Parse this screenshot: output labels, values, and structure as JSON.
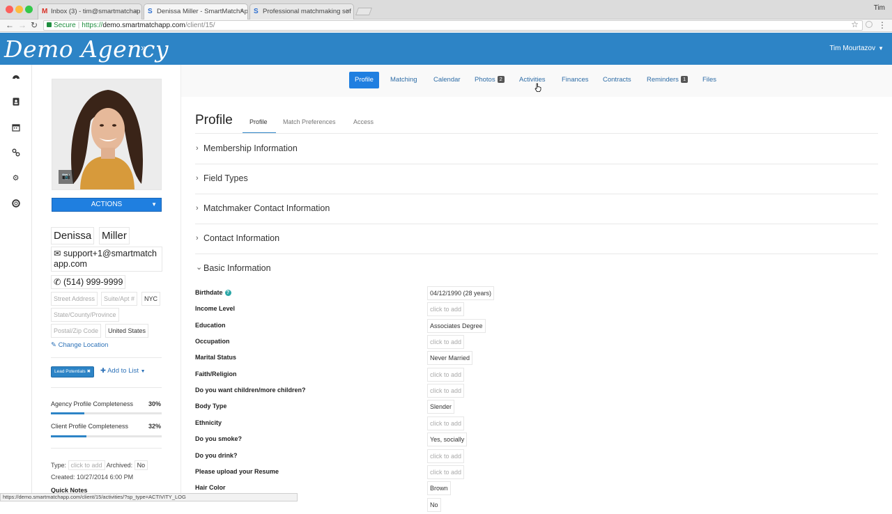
{
  "browser": {
    "tabs": [
      {
        "title": "Inbox (3) - tim@smartmatchap",
        "favicon": "gmail-icon"
      },
      {
        "title": "Denissa Miller - SmartMatchAp",
        "favicon": "smartmatch-icon"
      },
      {
        "title": "Professional matchmaking sof",
        "favicon": "smartmatch-icon"
      }
    ],
    "profile_name": "Tim",
    "secure_label": "Secure",
    "url_scheme": "https://",
    "url_host": "demo.smartmatchapp.com",
    "url_path": "/client/15/",
    "status_url": "https://demo.smartmatchapp.com/client/15/activities/?sp_type=ACTIVITY_LOG"
  },
  "app": {
    "logo": "Demo Agency",
    "account_name": "Tim Mourtazov",
    "accent": "#2d84c6"
  },
  "rail": [
    "dashboard-icon",
    "contacts-icon",
    "calendar-icon",
    "links-icon",
    "settings-icon",
    "help-icon"
  ],
  "client": {
    "actions_label": "ACTIONS",
    "first_name": "Denissa",
    "last_name": "Miller",
    "email": "support+1@smartmatchapp.com",
    "phone": "(514) 999-9999",
    "street_placeholder": "Street Address",
    "suite_placeholder": "Suite/Apt #",
    "city": "NYC",
    "state_placeholder": "State/County/Province",
    "postal_placeholder": "Postal/Zip Code",
    "country": "United States",
    "change_location": "Change Location",
    "tag": "Lead Potentials",
    "add_to_list": "Add to List",
    "agency_completeness_label": "Agency Profile Completeness",
    "agency_completeness": "30%",
    "agency_completeness_value": 0.3,
    "client_completeness_label": "Client Profile Completeness",
    "client_completeness": "32%",
    "client_completeness_value": 0.32,
    "type_label": "Type:",
    "type_value": "click to add",
    "archived_label": "Archived:",
    "archived_value": "No",
    "created": "Created: 10/27/2014 6:00 PM",
    "quick_notes": "Quick Notes"
  },
  "nav": [
    {
      "label": "Profile",
      "active": true
    },
    {
      "label": "Matching"
    },
    {
      "label": "Calendar"
    },
    {
      "label": "Photos",
      "badge": "2"
    },
    {
      "label": "Activities"
    },
    {
      "label": "Finances"
    },
    {
      "label": "Contracts"
    },
    {
      "label": "Reminders",
      "badge": "1"
    },
    {
      "label": "Files"
    }
  ],
  "profile": {
    "title": "Profile",
    "subtabs": [
      "Profile",
      "Match Preferences",
      "Access"
    ],
    "sections": [
      "Membership Information",
      "Field Types",
      "Matchmaker Contact Information",
      "Contact Information",
      "Basic Information"
    ],
    "fields": [
      {
        "label": "Birthdate",
        "value": "04/12/1990 (28 years)",
        "help": true
      },
      {
        "label": "Income Level",
        "value": "click to add",
        "empty": true
      },
      {
        "label": "Education",
        "value": "Associates Degree"
      },
      {
        "label": "Occupation",
        "value": "click to add",
        "empty": true
      },
      {
        "label": "Marital Status",
        "value": "Never Married"
      },
      {
        "label": "Faith/Religion",
        "value": "click to add",
        "empty": true
      },
      {
        "label": "Do you want children/more children?",
        "value": "click to add",
        "empty": true
      },
      {
        "label": "Body Type",
        "value": "Slender"
      },
      {
        "label": "Ethnicity",
        "value": "click to add",
        "empty": true
      },
      {
        "label": "Do you smoke?",
        "value": "Yes, socially"
      },
      {
        "label": "Do you drink?",
        "value": "click to add",
        "empty": true
      },
      {
        "label": "Please upload your Resume",
        "value": "click to add",
        "empty": true
      },
      {
        "label": "Hair Color",
        "value": "Brown"
      },
      {
        "label": "",
        "value": "No"
      }
    ]
  }
}
